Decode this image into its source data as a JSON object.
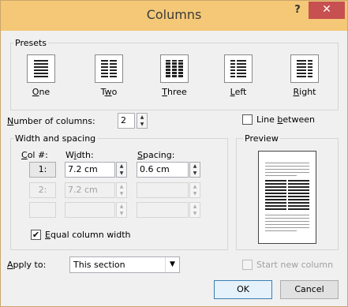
{
  "dialog": {
    "title": "Columns",
    "help_symbol": "?",
    "close_symbol": "✕"
  },
  "presets": {
    "legend": "Presets",
    "items": [
      {
        "label": "One",
        "accel": "O",
        "rest": "ne",
        "pre": "",
        "icon": "preset-one-column-icon"
      },
      {
        "label": "Two",
        "accel": "w",
        "rest": "o",
        "pre": "T",
        "icon": "preset-two-columns-icon"
      },
      {
        "label": "Three",
        "accel": "T",
        "rest": "hree",
        "pre": "",
        "icon": "preset-three-columns-icon"
      },
      {
        "label": "Left",
        "accel": "L",
        "rest": "eft",
        "pre": "",
        "icon": "preset-left-column-icon"
      },
      {
        "label": "Right",
        "accel": "R",
        "rest": "ight",
        "pre": "",
        "icon": "preset-right-column-icon"
      }
    ]
  },
  "number_of_columns": {
    "label_accel": "N",
    "label_rest": "umber of columns:",
    "value": "2"
  },
  "line_between": {
    "label_pre": "Line ",
    "label_accel": "b",
    "label_rest": "etween",
    "checked": false
  },
  "width_spacing": {
    "legend": "Width and spacing",
    "col_header_accel": "C",
    "col_header_rest": "ol #:",
    "width_header_pre": "W",
    "width_header_accel": "i",
    "width_header_rest": "dth:",
    "spacing_header_accel": "S",
    "spacing_header_rest": "pacing:",
    "rows": [
      {
        "col": "1:",
        "width": "7.2 cm",
        "spacing": "0.6 cm",
        "enabled": true
      },
      {
        "col": "2:",
        "width": "7.2 cm",
        "spacing": "",
        "enabled": false
      },
      {
        "col": "",
        "width": "",
        "spacing": "",
        "enabled": false
      }
    ],
    "equal_width_accel": "E",
    "equal_width_rest": "qual column width",
    "equal_width_checked": true
  },
  "preview": {
    "legend": "Preview"
  },
  "apply_to": {
    "label_accel": "A",
    "label_rest": "pply to:",
    "value": "This section"
  },
  "start_new_column": {
    "label": "Start new column",
    "checked": false
  },
  "buttons": {
    "ok": "OK",
    "cancel": "Cancel"
  }
}
